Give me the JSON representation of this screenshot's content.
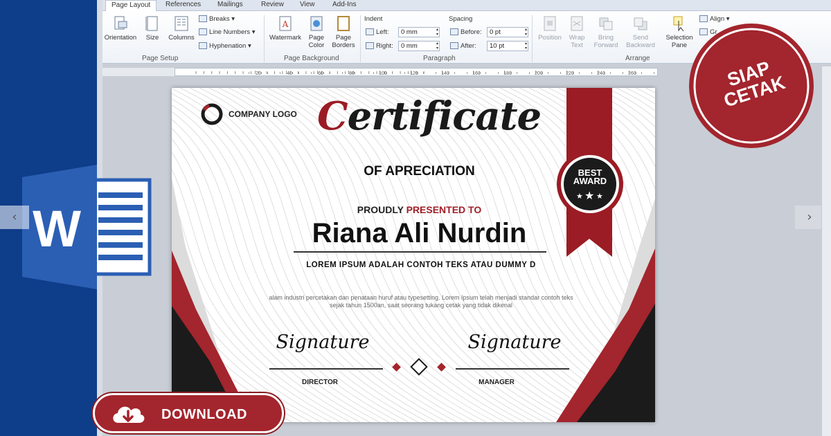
{
  "ribbon": {
    "tabs": [
      "Page Layout",
      "References",
      "Mailings",
      "Review",
      "View",
      "Add-Ins"
    ],
    "page_setup": {
      "orientation": "Orientation",
      "size": "Size",
      "columns": "Columns",
      "breaks": "Breaks",
      "line_numbers": "Line Numbers",
      "hyphenation": "Hyphenation",
      "group_label": "Page Setup"
    },
    "page_background": {
      "watermark": "Watermark",
      "page_color": "Page Color",
      "page_borders": "Page Borders",
      "group_label": "Page Background"
    },
    "paragraph": {
      "indent_label": "Indent",
      "left_label": "Left:",
      "left_value": "0 mm",
      "right_label": "Right:",
      "right_value": "0 mm",
      "spacing_label": "Spacing",
      "before_label": "Before:",
      "before_value": "0 pt",
      "after_label": "After:",
      "after_value": "10 pt",
      "group_label": "Paragraph"
    },
    "arrange": {
      "position": "Position",
      "wrap_text": "Wrap Text",
      "bring_forward": "Bring Forward",
      "send_backward": "Send Backward",
      "selection_pane": "Selection Pane",
      "align": "Align",
      "group_short": "Gr",
      "group_label": "Arrange"
    }
  },
  "ruler": {
    "numbers": [
      "20",
      "40",
      "60",
      "80",
      "100",
      "120",
      "140",
      "160",
      "180",
      "200",
      "220",
      "240",
      "260",
      "280"
    ]
  },
  "certificate": {
    "company_logo": "COMPANY LOGO",
    "title_first": "C",
    "title_rest": "ertificate",
    "subtitle": "OF APRECIATION",
    "presented_prefix": "PROUDLY ",
    "presented_red": "PRESENTED TO",
    "recipient": "Riana Ali Nurdin",
    "lorem_head": "LOREM IPSUM ADALAH CONTOH TEKS ATAU DUMMY D",
    "body": "alam industri percetakan dan penataan huruf atau typesetting. Lorem Ipsum telah menjadi standar contoh teks sejak tahun 1500an, saat seorang tukang cetak yang tidak dikenal",
    "signature_left": "Signature",
    "signature_right": "Signature",
    "role_left": "DIRECTOR",
    "role_right": "MANAGER",
    "badge_line1": "BEST",
    "badge_line2": "AWARD",
    "accent_color": "#9b1c24"
  },
  "stamp": {
    "line1": "SIAP",
    "line2": "CETAK"
  },
  "download": {
    "label": "DOWNLOAD"
  },
  "colors": {
    "brand_blue": "#0e3d8a",
    "accent_red": "#a3252d"
  }
}
